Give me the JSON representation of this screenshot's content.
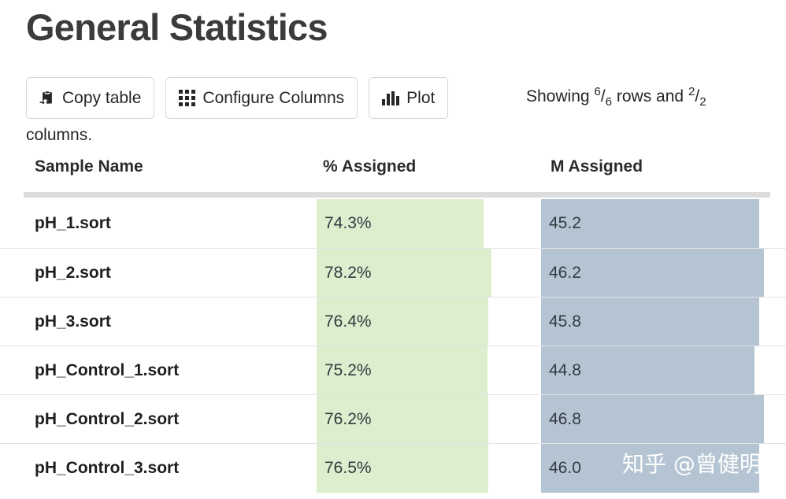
{
  "page": {
    "title": "General Statistics"
  },
  "toolbar": {
    "copy_table": {
      "label": "Copy table",
      "icon": "clipboard-arrow-icon"
    },
    "configure_columns": {
      "label": "Configure Columns",
      "icon": "grid-3x3-icon"
    },
    "plot": {
      "label": "Plot",
      "icon": "bar-chart-icon"
    }
  },
  "status": {
    "showing_prefix": "Showing ",
    "rows_shown": "6",
    "rows_total": "6",
    "mid_text": " rows and ",
    "cols_shown": "2",
    "cols_total": "2",
    "continuation": "columns."
  },
  "table": {
    "columns": [
      "Sample Name",
      "% Assigned",
      "M Assigned"
    ],
    "rows": [
      {
        "name": "pH_1.sort",
        "pct_assigned": "74.3%",
        "m_assigned": "45.2"
      },
      {
        "name": "pH_2.sort",
        "pct_assigned": "78.2%",
        "m_assigned": "46.2"
      },
      {
        "name": "pH_3.sort",
        "pct_assigned": "76.4%",
        "m_assigned": "45.8"
      },
      {
        "name": "pH_Control_1.sort",
        "pct_assigned": "75.2%",
        "m_assigned": "44.8"
      },
      {
        "name": "pH_Control_2.sort",
        "pct_assigned": "76.2%",
        "m_assigned": "46.8"
      },
      {
        "name": "pH_Control_3.sort",
        "pct_assigned": "76.5%",
        "m_assigned": "46.0"
      }
    ]
  },
  "colors": {
    "pct_bar": "#dbeecd",
    "m_bar": "#b4c4d2",
    "title_text": "#3b3b3b",
    "header_rule": "#dcdcdc"
  },
  "chart_data": {
    "type": "table",
    "title": "General Statistics",
    "categories": [
      "pH_1.sort",
      "pH_2.sort",
      "pH_3.sort",
      "pH_Control_1.sort",
      "pH_Control_2.sort",
      "pH_Control_3.sort"
    ],
    "series": [
      {
        "name": "% Assigned",
        "values": [
          74.3,
          78.2,
          76.4,
          75.2,
          76.2,
          76.5
        ],
        "unit": "%",
        "bar_color": "#dbeecd"
      },
      {
        "name": "M Assigned",
        "values": [
          45.2,
          46.2,
          45.8,
          44.8,
          46.8,
          46.0
        ],
        "unit": "M",
        "bar_color": "#b4c4d2"
      }
    ]
  },
  "watermark": {
    "text": "知乎 @曾健明"
  },
  "_bar_geometry": {
    "pct_left": 402,
    "pct_widths": [
      212,
      222,
      218,
      217,
      218,
      218
    ],
    "m_left": 687,
    "m_widths": [
      277,
      283,
      277,
      271,
      283,
      277
    ]
  }
}
